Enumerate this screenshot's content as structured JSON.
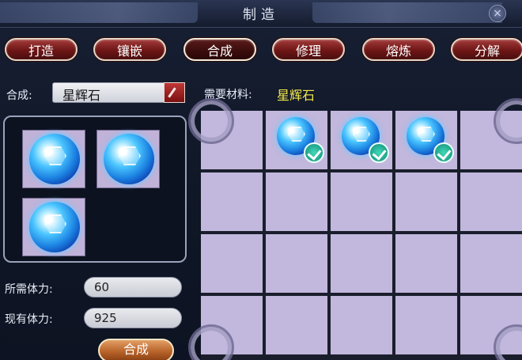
{
  "window": {
    "title": "制造"
  },
  "tabs": [
    {
      "label": "打造",
      "active": false
    },
    {
      "label": "镶嵌",
      "active": false
    },
    {
      "label": "合成",
      "active": true
    },
    {
      "label": "修理",
      "active": false
    },
    {
      "label": "熔炼",
      "active": false
    },
    {
      "label": "分解",
      "active": false
    }
  ],
  "recipe": {
    "label": "合成:",
    "selected": "星辉石",
    "required_label": "需要材料:",
    "required_value": "星辉石"
  },
  "inventory": {
    "item_icon": "blue-gem-icon",
    "count": 3
  },
  "stamina": {
    "required_label": "所需体力:",
    "required_value": "60",
    "current_label": "现有体力:",
    "current_value": "925"
  },
  "actions": {
    "craft_label": "合成"
  },
  "grid": {
    "rows": 4,
    "cols": 5,
    "filled_icon": "blue-gem-icon",
    "check_icon": "check-icon"
  },
  "colors": {
    "accent_yellow": "#f4e84a",
    "tab_red": "#6e1616",
    "slot_lavender": "#c2b7dc",
    "craft_orange": "#b9642a"
  }
}
